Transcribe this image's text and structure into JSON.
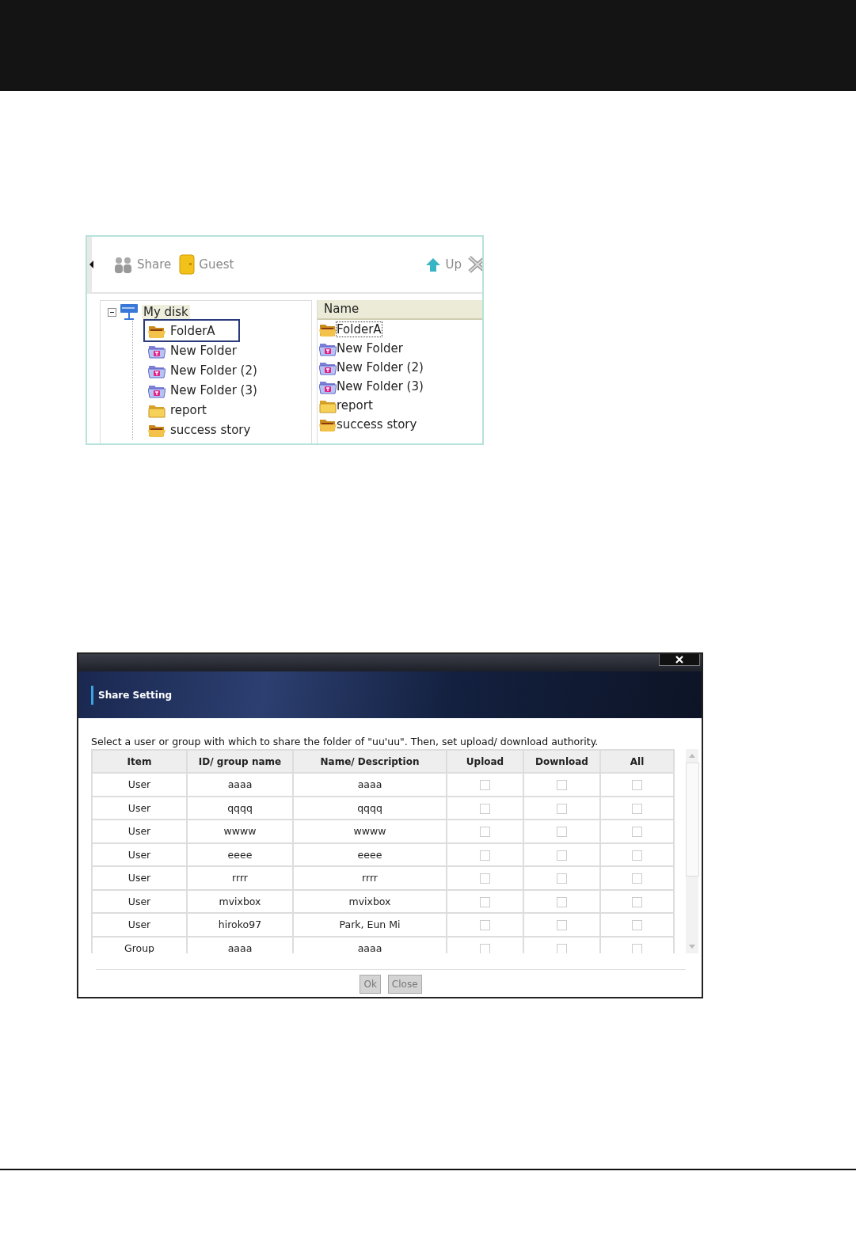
{
  "file_browser": {
    "toolbar": [
      {
        "kind": "share",
        "label": "Share"
      },
      {
        "kind": "guest",
        "label": "Guest"
      },
      {
        "kind": "up",
        "label": "Up"
      },
      {
        "kind": "delete"
      }
    ],
    "tree": {
      "label": "My disk",
      "expanded": true,
      "children": [
        {
          "label": "FolderA",
          "kind": "open",
          "selected": true
        },
        {
          "label": "New Folder",
          "kind": "shared",
          "selected": false
        },
        {
          "label": "New Folder (2)",
          "kind": "shared",
          "selected": false
        },
        {
          "label": "New Folder (3)",
          "kind": "shared",
          "selected": false
        },
        {
          "label": "report",
          "kind": "closed",
          "selected": false
        },
        {
          "label": "success story",
          "kind": "open",
          "selected": false
        }
      ]
    },
    "list": {
      "column": "Name",
      "items": [
        {
          "label": "FolderA",
          "kind": "open",
          "selected": true
        },
        {
          "label": "New Folder",
          "kind": "shared",
          "selected": false
        },
        {
          "label": "New Folder (2)",
          "kind": "shared",
          "selected": false
        },
        {
          "label": "New Folder (3)",
          "kind": "shared",
          "selected": false
        },
        {
          "label": "report",
          "kind": "closed",
          "selected": false
        },
        {
          "label": "success story",
          "kind": "open",
          "selected": false
        }
      ]
    }
  },
  "dialog": {
    "title": "Share Setting",
    "instruction": "Select a user or group with which to share the folder of \"uu'uu\". Then, set upload/ download authority.",
    "columns": [
      "Item",
      "ID/ group name",
      "Name/ Description",
      "Upload",
      "Download",
      "All"
    ],
    "rows": [
      {
        "item": "User",
        "id": "aaaa",
        "name": "aaaa",
        "upload": false,
        "download": false,
        "all": false
      },
      {
        "item": "User",
        "id": "qqqq",
        "name": "qqqq",
        "upload": false,
        "download": false,
        "all": false
      },
      {
        "item": "User",
        "id": "wwww",
        "name": "wwww",
        "upload": false,
        "download": false,
        "all": false
      },
      {
        "item": "User",
        "id": "eeee",
        "name": "eeee",
        "upload": false,
        "download": false,
        "all": false
      },
      {
        "item": "User",
        "id": "rrrr",
        "name": "rrrr",
        "upload": false,
        "download": false,
        "all": false
      },
      {
        "item": "User",
        "id": "mvixbox",
        "name": "mvixbox",
        "upload": false,
        "download": false,
        "all": false
      },
      {
        "item": "User",
        "id": "hiroko97",
        "name": "Park, Eun Mi",
        "upload": false,
        "download": false,
        "all": false
      },
      {
        "item": "Group",
        "id": "aaaa",
        "name": "aaaa",
        "upload": false,
        "download": false,
        "all": false
      }
    ],
    "buttons": [
      "Ok",
      "Close"
    ]
  }
}
